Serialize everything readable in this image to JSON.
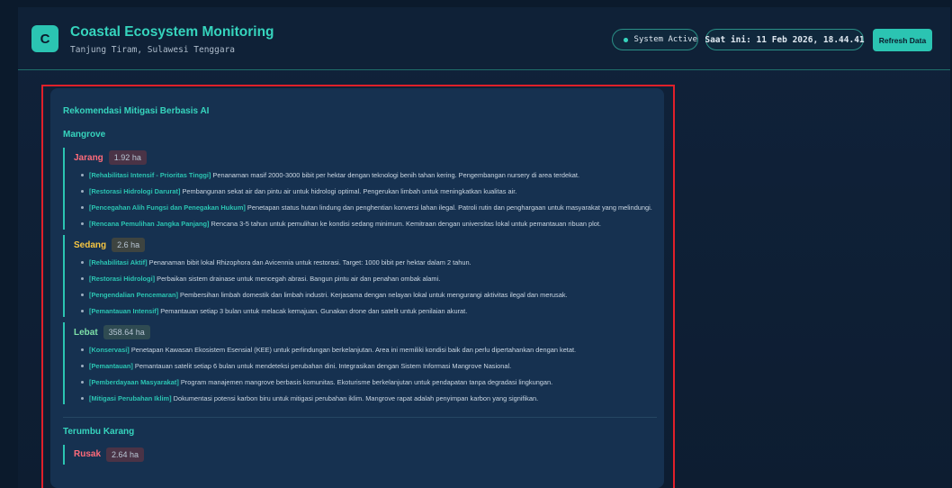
{
  "header": {
    "logo_letter": "C",
    "title": "Coastal Ecosystem Monitoring",
    "subtitle": "Tanjung Tiram, Sulawesi Tenggara",
    "status": "System Active",
    "time": "Saat ini: 11 Feb 2026, 18.44.41",
    "refresh_label": "Refresh Data"
  },
  "panel": {
    "title": "Rekomendasi Mitigasi Berbasis AI",
    "mangrove": {
      "title": "Mangrove",
      "levels": [
        {
          "name": "Jarang",
          "area": "1.92 ha",
          "color": "#ff6b7a",
          "items": [
            {
              "tag": "[Rehabilitasi Intensif - Prioritas Tinggi]",
              "text": " Penanaman masif 2000-3000 bibit per hektar dengan teknologi benih tahan kering. Pengembangan nursery di area terdekat."
            },
            {
              "tag": "[Restorasi Hidrologi Darurat]",
              "text": " Pembangunan sekat air dan pintu air untuk hidrologi optimal. Pengerukan limbah untuk meningkatkan kualitas air."
            },
            {
              "tag": "[Pencegahan Alih Fungsi dan Penegakan Hukum]",
              "text": " Penetapan status hutan lindung dan penghentian konversi lahan ilegal. Patroli rutin dan penghargaan untuk masyarakat yang melindungi."
            },
            {
              "tag": "[Rencana Pemulihan Jangka Panjang]",
              "text": " Rencana 3-5 tahun untuk pemulihan ke kondisi sedang minimum. Kemitraan dengan universitas lokal untuk pemantauan ribuan plot."
            }
          ]
        },
        {
          "name": "Sedang",
          "area": "2.6 ha",
          "color": "#f5c542",
          "items": [
            {
              "tag": "[Rehabilitasi Aktif]",
              "text": " Penanaman bibit lokal Rhizophora dan Avicennia untuk restorasi. Target: 1000 bibit per hektar dalam 2 tahun."
            },
            {
              "tag": "[Restorasi Hidrologi]",
              "text": " Perbaikan sistem drainase untuk mencegah abrasi. Bangun pintu air dan penahan ombak alami."
            },
            {
              "tag": "[Pengendalian Pencemaran]",
              "text": " Pembersihan limbah domestik dan limbah industri. Kerjasama dengan nelayan lokal untuk mengurangi aktivitas ilegal dan merusak."
            },
            {
              "tag": "[Pemantauan Intensif]",
              "text": " Pemantauan setiap 3 bulan untuk melacak kemajuan. Gunakan drone dan satelit untuk penilaian akurat."
            }
          ]
        },
        {
          "name": "Lebat",
          "area": "358.64 ha",
          "color": "#7ee0a8",
          "items": [
            {
              "tag": "[Konservasi]",
              "text": " Penetapan Kawasan Ekosistem Esensial (KEE) untuk perlindungan berkelanjutan. Area ini memiliki kondisi baik dan perlu dipertahankan dengan ketat."
            },
            {
              "tag": "[Pemantauan]",
              "text": " Pemantauan satelit setiap 6 bulan untuk mendeteksi perubahan dini. Integrasikan dengan Sistem Informasi Mangrove Nasional."
            },
            {
              "tag": "[Pemberdayaan Masyarakat]",
              "text": " Program manajemen mangrove berbasis komunitas. Ekoturisme berkelanjutan untuk pendapatan tanpa degradasi lingkungan."
            },
            {
              "tag": "[Mitigasi Perubahan Iklim]",
              "text": " Dokumentasi potensi karbon biru untuk mitigasi perubahan iklim. Mangrove rapat adalah penyimpan karbon yang signifikan."
            }
          ]
        }
      ]
    },
    "terumbu": {
      "title": "Terumbu Karang",
      "levels": [
        {
          "name": "Rusak",
          "area": "2.64 ha",
          "color": "#ff6b7a"
        }
      ]
    }
  }
}
